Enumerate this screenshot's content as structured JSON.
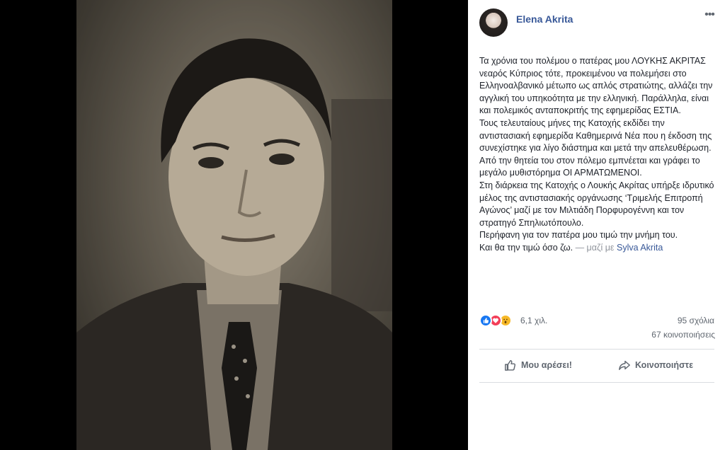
{
  "photo": {
    "icon": "portrait-photo"
  },
  "post": {
    "author": "Elena Akrita",
    "body_lines": [
      "Τα χρόνια του πολέμου ο πατέρας μου ΛΟΥΚΗΣ ΑΚΡΙΤΑΣ νεαρός Κύπριος τότε, προκειμένου να πολεμήσει στο Ελληνοαλβανικό μέτωπο ως απλός στρατιώτης, αλλάζει την αγγλική του υπηκοότητα με την ελληνική. Παράλληλα, είναι και πολεμικός ανταποκριτής της εφημερίδας ΕΣΤΙΑ.",
      "Τους τελευταίους μήνες της Κατοχής εκδίδει την αντιστασιακή εφημερίδα Καθημερινά Νέα που η έκδοση της συνεχίστηκε για λίγο διάστημα και μετά την απελευθέρωση. Από την θητεία του στον πόλεμο εμπνέεται και γράφει το μεγάλο μυθιστόρημα ΟΙ ΑΡΜΑΤΩΜΕΝΟΙ.",
      "Στη διάρκεια της Κατοχής ο Λουκής Ακρίτας υπήρξε ιδρυτικό μέλος της αντιστασιακής οργάνωσης ‘Τριμελής Επιτροπή Αγώνος’ μαζί με τον Μιλτιάδη Πορφυρογέννη και τον στρατηγό Σπηλιωτόπουλο.",
      "Περήφανη για τον πατέρα μου τιμώ την μνήμη του.",
      "Και θα την τιμώ όσο ζω."
    ],
    "with_prefix": "— μαζί με",
    "tagged_person": "Sylva Akrita"
  },
  "stats": {
    "reactions": "6,1 χιλ.",
    "comments": "95 σχόλια",
    "shares": "67 κοινοποιήσεις"
  },
  "actions": {
    "like_label": "Μου αρέσει!",
    "share_label": "Κοινοποιήστε"
  },
  "colors": {
    "link": "#385898",
    "text": "#1d2129",
    "muted": "#606770",
    "like": "#1877f2",
    "love": "#f33e58",
    "wow": "#f7b928"
  }
}
